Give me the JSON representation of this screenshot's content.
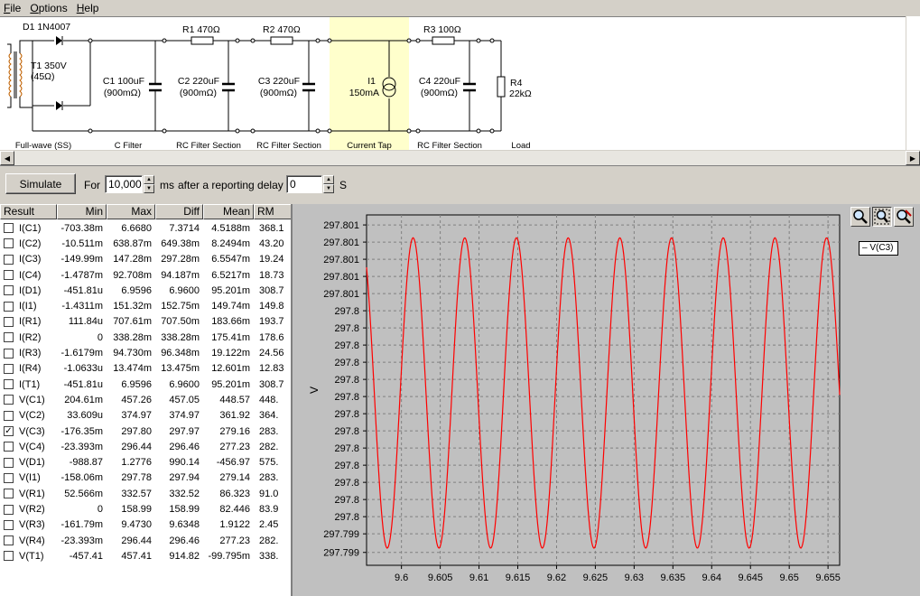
{
  "menu": {
    "items": [
      {
        "label": "File",
        "accel": "F",
        "rest": "ile"
      },
      {
        "label": "Options",
        "accel": "O",
        "rest": "ptions"
      },
      {
        "label": "Help",
        "accel": "H",
        "rest": "elp"
      }
    ]
  },
  "schematic": {
    "diode": "D1 1N4007",
    "transformer": "T1 350V",
    "transformer2": "(45Ω)",
    "r1": "R1 470Ω",
    "r2": "R2 470Ω",
    "r3": "R3 100Ω",
    "c1a": "C1 100uF",
    "c1b": "(900mΩ)",
    "c2a": "C2 220uF",
    "c2b": "(900mΩ)",
    "c3a": "C3 220uF",
    "c3b": "(900mΩ)",
    "i1a": "I1",
    "i1b": "150mA",
    "c4a": "C4 220uF",
    "c4b": "(900mΩ)",
    "r4a": "R4",
    "r4b": "22kΩ",
    "sections": [
      "Full-wave (SS)",
      "C Filter",
      "RC Filter Section",
      "RC Filter Section",
      "Current Tap",
      "RC Filter Section",
      "Load"
    ],
    "highlight_color": "#ffffcc"
  },
  "sim": {
    "simulate": "Simulate",
    "for": "For",
    "duration": "10,000",
    "ms": "ms",
    "after": "after a reporting delay of",
    "delay": "0",
    "s": "S"
  },
  "table": {
    "headers": [
      "Result",
      "Min",
      "Max",
      "Diff",
      "Mean",
      "RM"
    ],
    "rows": [
      {
        "name": "I(C1)",
        "checked": false,
        "min": "-703.38m",
        "max": "6.6680",
        "diff": "7.3714",
        "mean": "4.5188m",
        "rm": "368.1"
      },
      {
        "name": "I(C2)",
        "checked": false,
        "min": "-10.511m",
        "max": "638.87m",
        "diff": "649.38m",
        "mean": "8.2494m",
        "rm": "43.20"
      },
      {
        "name": "I(C3)",
        "checked": false,
        "min": "-149.99m",
        "max": "147.28m",
        "diff": "297.28m",
        "mean": "6.5547m",
        "rm": "19.24"
      },
      {
        "name": "I(C4)",
        "checked": false,
        "min": "-1.4787m",
        "max": "92.708m",
        "diff": "94.187m",
        "mean": "6.5217m",
        "rm": "18.73"
      },
      {
        "name": "I(D1)",
        "checked": false,
        "min": "-451.81u",
        "max": "6.9596",
        "diff": "6.9600",
        "mean": "95.201m",
        "rm": "308.7"
      },
      {
        "name": "I(I1)",
        "checked": false,
        "min": "-1.4311m",
        "max": "151.32m",
        "diff": "152.75m",
        "mean": "149.74m",
        "rm": "149.8"
      },
      {
        "name": "I(R1)",
        "checked": false,
        "min": "111.84u",
        "max": "707.61m",
        "diff": "707.50m",
        "mean": "183.66m",
        "rm": "193.7"
      },
      {
        "name": "I(R2)",
        "checked": false,
        "min": "0",
        "max": "338.28m",
        "diff": "338.28m",
        "mean": "175.41m",
        "rm": "178.6"
      },
      {
        "name": "I(R3)",
        "checked": false,
        "min": "-1.6179m",
        "max": "94.730m",
        "diff": "96.348m",
        "mean": "19.122m",
        "rm": "24.56"
      },
      {
        "name": "I(R4)",
        "checked": false,
        "min": "-1.0633u",
        "max": "13.474m",
        "diff": "13.475m",
        "mean": "12.601m",
        "rm": "12.83"
      },
      {
        "name": "I(T1)",
        "checked": false,
        "min": "-451.81u",
        "max": "6.9596",
        "diff": "6.9600",
        "mean": "95.201m",
        "rm": "308.7"
      },
      {
        "name": "V(C1)",
        "checked": false,
        "min": "204.61m",
        "max": "457.26",
        "diff": "457.05",
        "mean": "448.57",
        "rm": "448."
      },
      {
        "name": "V(C2)",
        "checked": false,
        "min": "33.609u",
        "max": "374.97",
        "diff": "374.97",
        "mean": "361.92",
        "rm": "364."
      },
      {
        "name": "V(C3)",
        "checked": true,
        "min": "-176.35m",
        "max": "297.80",
        "diff": "297.97",
        "mean": "279.16",
        "rm": "283."
      },
      {
        "name": "V(C4)",
        "checked": false,
        "min": "-23.393m",
        "max": "296.44",
        "diff": "296.46",
        "mean": "277.23",
        "rm": "282."
      },
      {
        "name": "V(D1)",
        "checked": false,
        "min": "-988.87",
        "max": "1.2776",
        "diff": "990.14",
        "mean": "-456.97",
        "rm": "575."
      },
      {
        "name": "V(I1)",
        "checked": false,
        "min": "-158.06m",
        "max": "297.78",
        "diff": "297.94",
        "mean": "279.14",
        "rm": "283."
      },
      {
        "name": "V(R1)",
        "checked": false,
        "min": "52.566m",
        "max": "332.57",
        "diff": "332.52",
        "mean": "86.323",
        "rm": "91.0"
      },
      {
        "name": "V(R2)",
        "checked": false,
        "min": "0",
        "max": "158.99",
        "diff": "158.99",
        "mean": "82.446",
        "rm": "83.9"
      },
      {
        "name": "V(R3)",
        "checked": false,
        "min": "-161.79m",
        "max": "9.4730",
        "diff": "9.6348",
        "mean": "1.9122",
        "rm": "2.45"
      },
      {
        "name": "V(R4)",
        "checked": false,
        "min": "-23.393m",
        "max": "296.44",
        "diff": "296.46",
        "mean": "277.23",
        "rm": "282."
      },
      {
        "name": "V(T1)",
        "checked": false,
        "min": "-457.41",
        "max": "457.41",
        "diff": "914.82",
        "mean": "-99.795m",
        "rm": "338."
      }
    ]
  },
  "chart_data": {
    "type": "line",
    "xlabel": "",
    "ylabel": "V",
    "xlim": [
      9.5955,
      9.6565
    ],
    "ylim": [
      297.79886,
      297.80131
    ],
    "x_ticks": [
      9.6,
      9.605,
      9.61,
      9.615,
      9.62,
      9.625,
      9.63,
      9.635,
      9.64,
      9.645,
      9.65,
      9.655
    ],
    "x_tick_labels": [
      "9.6",
      "9.605",
      "9.61",
      "9.615",
      "9.62",
      "9.625",
      "9.63",
      "9.635",
      "9.64",
      "9.645",
      "9.65",
      "9.655"
    ],
    "y_ticks": [
      297.79895,
      297.79908,
      297.7992,
      297.79932,
      297.79944,
      297.79956,
      297.79968,
      297.7998,
      297.79992,
      297.80004,
      297.80016,
      297.80028,
      297.8004,
      297.80052,
      297.80064,
      297.80076,
      297.80088,
      297.801,
      297.80112,
      297.80124
    ],
    "y_tick_labels": [
      "297.799",
      "297.799",
      "297.8",
      "297.8",
      "297.8",
      "297.8",
      "297.8",
      "297.8",
      "297.8",
      "297.8",
      "297.8",
      "297.8",
      "297.8",
      "297.8",
      "297.8",
      "297.801",
      "297.801",
      "297.801",
      "297.801",
      "297.801"
    ],
    "grid": true,
    "legend": "top-right",
    "series": [
      {
        "name": "V(C3)",
        "color": "#ff0000",
        "period": 0.006665,
        "min": 297.79898,
        "max": 297.80115,
        "first_peak_x": 9.6015
      }
    ]
  },
  "colors": {
    "trace": "#ff0000",
    "plot_bg": "#c0c0c0",
    "grid": "#808080"
  }
}
